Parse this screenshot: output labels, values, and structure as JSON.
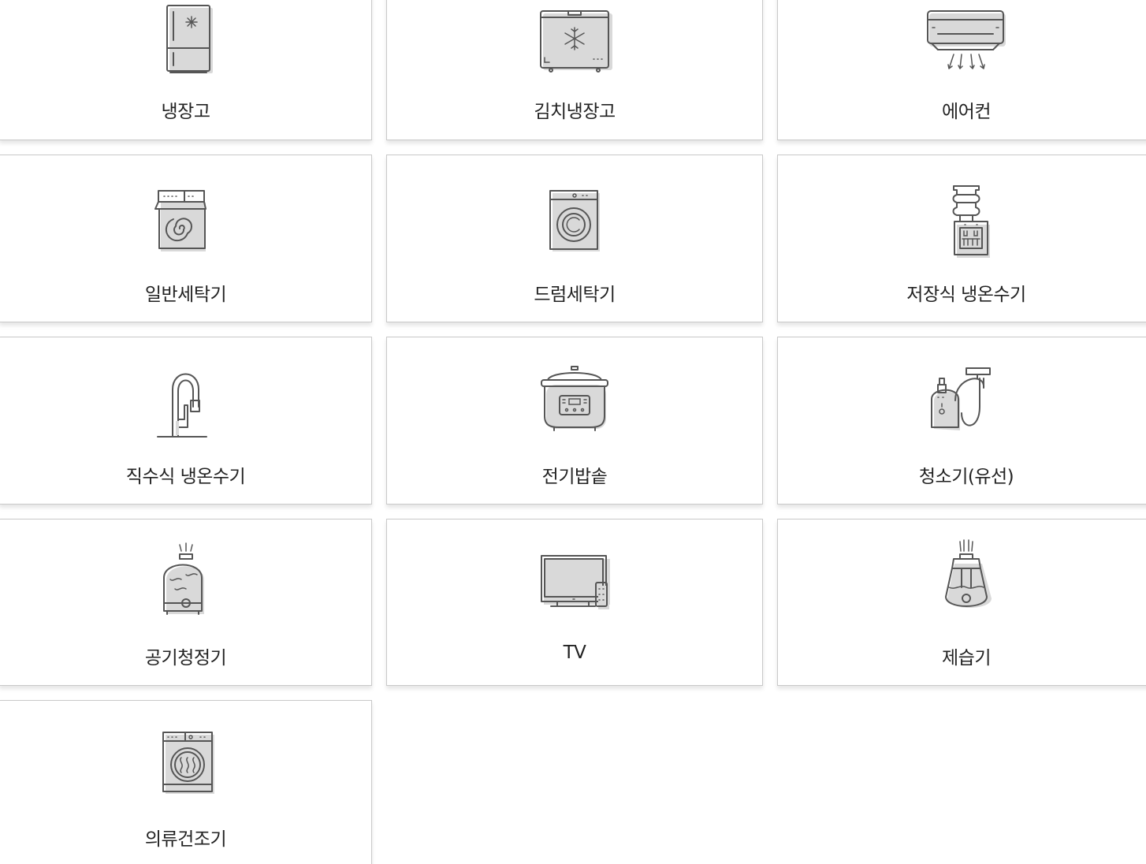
{
  "categories": [
    {
      "label": "냉장고",
      "icon": "refrigerator-icon"
    },
    {
      "label": "김치냉장고",
      "icon": "kimchi-refrigerator-icon"
    },
    {
      "label": "에어컨",
      "icon": "air-conditioner-icon"
    },
    {
      "label": "일반세탁기",
      "icon": "top-loader-washer-icon"
    },
    {
      "label": "드럼세탁기",
      "icon": "drum-washer-icon"
    },
    {
      "label": "저장식 냉온수기",
      "icon": "water-dispenser-icon"
    },
    {
      "label": "직수식 냉온수기",
      "icon": "faucet-water-purifier-icon"
    },
    {
      "label": "전기밥솥",
      "icon": "rice-cooker-icon"
    },
    {
      "label": "청소기(유선)",
      "icon": "vacuum-cleaner-icon"
    },
    {
      "label": "공기청정기",
      "icon": "air-purifier-icon"
    },
    {
      "label": "TV",
      "icon": "tv-icon"
    },
    {
      "label": "제습기",
      "icon": "dehumidifier-icon"
    },
    {
      "label": "의류건조기",
      "icon": "clothes-dryer-icon"
    }
  ],
  "colors": {
    "border": "#c9c9c9",
    "icon_stroke": "#555555",
    "text": "#222222"
  }
}
